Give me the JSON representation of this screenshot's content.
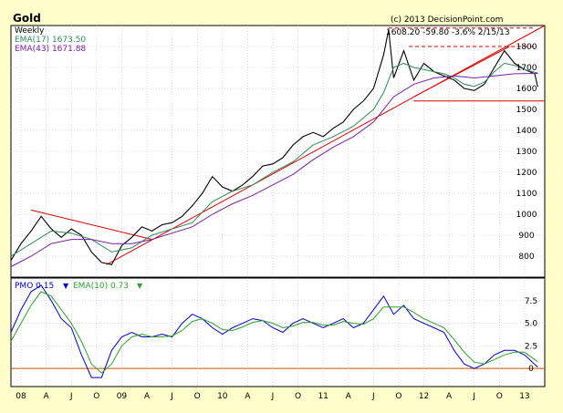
{
  "header": {
    "title": "Gold",
    "copyright": "(c) 2013 DecisionPoint.com",
    "period": "Weekly",
    "ema17": "EMA(17) 1673.50",
    "ema43": "EMA(43) 1671.88",
    "latest_quote": "1608.20  -59.80  -3.6%  2/15/13"
  },
  "colors": {
    "background": "#FFFFCC",
    "plot_bg": "#FFFFFF",
    "price": "#000000",
    "ema17": "#2E8B57",
    "ema43": "#7A1FA2",
    "trendline": "#E00000",
    "pmo": "#0000CC",
    "pmo_signal": "#2EA02E",
    "zero_line": "#D04A00",
    "grid": "#BBBBBB"
  },
  "chart_data": [
    {
      "type": "line",
      "name": "price-panel",
      "ylim": [
        700,
        1900
      ],
      "y_ticks": [
        "800",
        "900",
        "1000",
        "1100",
        "1200",
        "1300",
        "1400",
        "1500",
        "1600",
        "1700",
        "1800"
      ],
      "y_tick_values": [
        800,
        900,
        1000,
        1100,
        1200,
        1300,
        1400,
        1500,
        1600,
        1700,
        1800
      ],
      "x_ticks": [
        "08",
        "A",
        "J",
        "O",
        "09",
        "A",
        "J",
        "O",
        "10",
        "A",
        "J",
        "O",
        "11",
        "A",
        "J",
        "O",
        "12",
        "A",
        "J",
        "O",
        "13"
      ],
      "x_tick_values": [
        2008.0,
        2008.25,
        2008.5,
        2008.75,
        2009.0,
        2009.25,
        2009.5,
        2009.75,
        2010.0,
        2010.25,
        2010.5,
        2010.75,
        2011.0,
        2011.25,
        2011.5,
        2011.75,
        2012.0,
        2012.25,
        2012.5,
        2012.75,
        2013.0
      ],
      "xlim": [
        2007.9,
        2013.2
      ],
      "series": [
        {
          "name": "",
          "x": [
            2007.9,
            2008.0,
            2008.1,
            2008.2,
            2008.3,
            2008.4,
            2008.5,
            2008.6,
            2008.7,
            2008.8,
            2008.9,
            2009.0,
            2009.1,
            2009.2,
            2009.3,
            2009.4,
            2009.5,
            2009.6,
            2009.7,
            2009.8,
            2009.9,
            2010.0,
            2010.1,
            2010.2,
            2010.3,
            2010.4,
            2010.5,
            2010.6,
            2010.7,
            2010.8,
            2010.9,
            2011.0,
            2011.1,
            2011.2,
            2011.3,
            2011.4,
            2011.5,
            2011.6,
            2011.65,
            2011.7,
            2011.8,
            2011.9,
            2012.0,
            2012.1,
            2012.2,
            2012.3,
            2012.4,
            2012.5,
            2012.6,
            2012.7,
            2012.8,
            2012.9,
            2013.0,
            2013.1,
            2013.13
          ],
          "values": [
            780,
            860,
            920,
            990,
            930,
            890,
            930,
            900,
            820,
            770,
            760,
            850,
            890,
            940,
            920,
            950,
            960,
            990,
            1040,
            1100,
            1180,
            1130,
            1110,
            1140,
            1180,
            1230,
            1240,
            1270,
            1330,
            1370,
            1390,
            1370,
            1410,
            1440,
            1500,
            1540,
            1600,
            1760,
            1880,
            1650,
            1780,
            1640,
            1720,
            1680,
            1660,
            1640,
            1600,
            1590,
            1620,
            1700,
            1780,
            1720,
            1690,
            1670,
            1608
          ]
        },
        {
          "name": "EMA(17)",
          "x": [
            2007.9,
            2008.1,
            2008.3,
            2008.5,
            2008.7,
            2008.9,
            2009.1,
            2009.3,
            2009.5,
            2009.7,
            2009.9,
            2010.1,
            2010.3,
            2010.5,
            2010.7,
            2010.9,
            2011.1,
            2011.3,
            2011.5,
            2011.6,
            2011.7,
            2011.8,
            2011.9,
            2012.0,
            2012.1,
            2012.2,
            2012.3,
            2012.4,
            2012.5,
            2012.6,
            2012.7,
            2012.8,
            2012.9,
            2013.0,
            2013.13
          ],
          "values": [
            800,
            860,
            920,
            910,
            880,
            820,
            840,
            900,
            930,
            960,
            1060,
            1110,
            1140,
            1200,
            1250,
            1330,
            1370,
            1420,
            1500,
            1580,
            1700,
            1720,
            1700,
            1690,
            1680,
            1670,
            1650,
            1620,
            1610,
            1630,
            1680,
            1720,
            1710,
            1690,
            1673.5
          ]
        },
        {
          "name": "EMA(43)",
          "x": [
            2007.9,
            2008.1,
            2008.3,
            2008.5,
            2008.7,
            2008.9,
            2009.1,
            2009.3,
            2009.5,
            2009.7,
            2009.9,
            2010.1,
            2010.3,
            2010.5,
            2010.7,
            2010.9,
            2011.1,
            2011.3,
            2011.5,
            2011.7,
            2011.9,
            2012.1,
            2012.3,
            2012.5,
            2012.7,
            2012.9,
            2013.13
          ],
          "values": [
            750,
            800,
            860,
            880,
            880,
            860,
            860,
            880,
            910,
            940,
            1000,
            1050,
            1090,
            1140,
            1190,
            1260,
            1320,
            1370,
            1440,
            1560,
            1620,
            1650,
            1660,
            1650,
            1660,
            1670,
            1671.88
          ]
        }
      ],
      "annotations": [
        {
          "type": "trendline",
          "x": [
            2008.1,
            2009.3
          ],
          "values": [
            1020,
            880
          ]
        },
        {
          "type": "trendline",
          "x": [
            2008.85,
            2013.2
          ],
          "values": [
            760,
            1900
          ]
        },
        {
          "type": "trendline",
          "x": [
            2011.9,
            2012.85
          ],
          "values": [
            1560,
            1800
          ]
        },
        {
          "type": "hline-dashed",
          "x": [
            2011.65,
            2013.1
          ],
          "values": [
            1888,
            1888
          ]
        },
        {
          "type": "hline-dashed",
          "x": [
            2011.85,
            2013.1
          ],
          "values": [
            1800,
            1800
          ]
        },
        {
          "type": "hline",
          "x": [
            2011.9,
            2013.2
          ],
          "values": [
            1540,
            1540
          ]
        }
      ]
    },
    {
      "type": "line",
      "name": "pmo-panel",
      "ylim": [
        -2,
        10
      ],
      "y_ticks": [
        "0",
        "2.5",
        "5.0",
        "7.5"
      ],
      "y_tick_values": [
        0,
        2.5,
        5.0,
        7.5
      ],
      "xlim": [
        2007.9,
        2013.2
      ],
      "legend_pmo": "PMO  0.15",
      "legend_ema": "EMA(10)  0.73",
      "series": [
        {
          "name": "PMO",
          "x": [
            2007.9,
            2008.0,
            2008.1,
            2008.2,
            2008.3,
            2008.4,
            2008.5,
            2008.6,
            2008.7,
            2008.8,
            2008.9,
            2009.0,
            2009.1,
            2009.2,
            2009.3,
            2009.4,
            2009.5,
            2009.6,
            2009.7,
            2009.8,
            2009.9,
            2010.0,
            2010.1,
            2010.2,
            2010.3,
            2010.4,
            2010.5,
            2010.6,
            2010.7,
            2010.8,
            2010.9,
            2011.0,
            2011.1,
            2011.2,
            2011.3,
            2011.4,
            2011.5,
            2011.6,
            2011.7,
            2011.8,
            2011.9,
            2012.0,
            2012.1,
            2012.2,
            2012.3,
            2012.4,
            2012.5,
            2012.6,
            2012.7,
            2012.8,
            2012.9,
            2013.0,
            2013.13
          ],
          "values": [
            4.0,
            6.5,
            8.5,
            9.2,
            7.5,
            5.5,
            4.5,
            1.5,
            -1.0,
            -1.0,
            2.0,
            3.5,
            4.0,
            3.5,
            3.5,
            3.8,
            3.5,
            5.0,
            6.0,
            5.5,
            4.5,
            3.8,
            4.5,
            5.0,
            5.5,
            5.3,
            4.5,
            4.0,
            5.0,
            5.5,
            5.0,
            4.5,
            5.0,
            5.5,
            4.5,
            5.0,
            6.5,
            8.0,
            6.0,
            7.0,
            5.5,
            5.0,
            4.5,
            4.0,
            2.0,
            0.5,
            0.0,
            0.5,
            1.5,
            2.0,
            2.0,
            1.5,
            0.15
          ]
        },
        {
          "name": "EMA(10)",
          "x": [
            2007.9,
            2008.0,
            2008.1,
            2008.2,
            2008.3,
            2008.4,
            2008.5,
            2008.6,
            2008.7,
            2008.8,
            2008.9,
            2009.0,
            2009.1,
            2009.2,
            2009.3,
            2009.4,
            2009.5,
            2009.6,
            2009.7,
            2009.8,
            2009.9,
            2010.0,
            2010.1,
            2010.2,
            2010.3,
            2010.4,
            2010.5,
            2010.6,
            2010.7,
            2010.8,
            2010.9,
            2011.0,
            2011.1,
            2011.2,
            2011.3,
            2011.4,
            2011.5,
            2011.6,
            2011.7,
            2011.8,
            2011.9,
            2012.0,
            2012.1,
            2012.2,
            2012.3,
            2012.4,
            2012.5,
            2012.6,
            2012.7,
            2012.8,
            2012.9,
            2013.0,
            2013.13
          ],
          "values": [
            3.0,
            5.0,
            7.0,
            8.5,
            8.0,
            6.5,
            5.0,
            3.0,
            0.5,
            -0.5,
            0.5,
            2.5,
            3.5,
            3.8,
            3.5,
            3.5,
            3.6,
            4.2,
            5.2,
            5.5,
            5.0,
            4.3,
            4.2,
            4.6,
            5.1,
            5.3,
            5.0,
            4.5,
            4.7,
            5.1,
            5.1,
            4.8,
            4.8,
            5.2,
            5.0,
            4.9,
            5.5,
            6.8,
            6.8,
            6.8,
            6.2,
            5.5,
            5.0,
            4.5,
            3.2,
            1.8,
            0.7,
            0.5,
            1.0,
            1.5,
            1.8,
            1.8,
            0.73
          ]
        }
      ]
    }
  ]
}
